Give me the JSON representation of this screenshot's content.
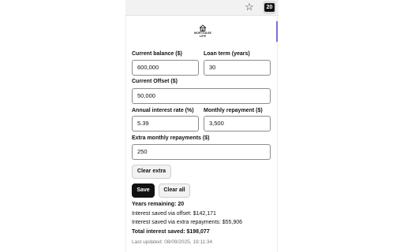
{
  "toolbar": {
    "star_glyph": "☆",
    "extension_badge": "20"
  },
  "logo": {
    "text_line1": "MORTGAGE",
    "text_line2": "LIFE"
  },
  "form": {
    "current_balance": {
      "label": "Current balance ($)",
      "value": "600,000"
    },
    "loan_term": {
      "label": "Loan term (years)",
      "value": "30"
    },
    "current_offset": {
      "label": "Current Offset ($)",
      "value": "50,000"
    },
    "interest_rate": {
      "label": "Annual interest rate (%)",
      "value": "5.39"
    },
    "monthly_repayment": {
      "label": "Monthly repayment ($)",
      "value": "3,500"
    },
    "extra_repayments": {
      "label": "Extra monthly repayments ($)",
      "value": "250"
    }
  },
  "buttons": {
    "clear_extra": "Clear extra",
    "save": "Save",
    "clear_all": "Clear all"
  },
  "results": {
    "years_remaining": "Years remaining: 20",
    "saved_offset": "Interest saved via offset: $142,171",
    "saved_extra": "Interest saved via extra repayments: $55,906",
    "total_saved": "Total interest saved: $198,077",
    "last_updated": "Last updated: 08/09/2025, 19:11:34"
  },
  "colors": {
    "accent": "#7b6fd6",
    "primary_button": "#111111"
  }
}
